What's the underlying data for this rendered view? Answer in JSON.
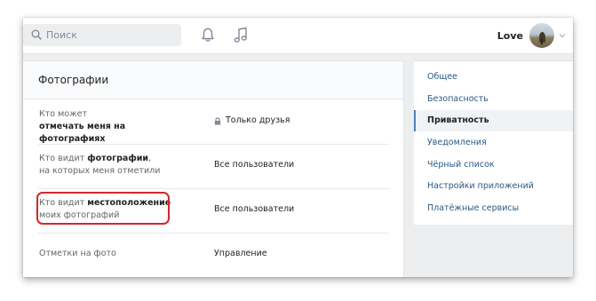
{
  "header": {
    "search_placeholder": "Поиск",
    "user_name": "Love"
  },
  "photos": {
    "title": "Фотографии",
    "rows": [
      {
        "label_pre": "Кто может",
        "label_bold": "отмечать меня на фотографиях",
        "label_post": "",
        "value": "Только друзья",
        "locked": true
      },
      {
        "label_pre": "Кто видит ",
        "label_bold": "фотографии",
        "label_post": ",",
        "label_line2": "на которых меня отметили",
        "value": "Все пользователи",
        "locked": false
      },
      {
        "label_pre": "Кто видит ",
        "label_bold": "местоположение",
        "label_line2": "моих фотографий",
        "value": "Все пользователи",
        "locked": false
      },
      {
        "label": "Отметки на фото",
        "value": "Управление",
        "locked": false
      }
    ]
  },
  "sidebar": {
    "items": [
      {
        "label": "Общее"
      },
      {
        "label": "Безопасность"
      },
      {
        "label": "Приватность",
        "active": true
      },
      {
        "label": "Уведомления"
      },
      {
        "label": "Чёрный список"
      },
      {
        "label": "Настройки приложений"
      },
      {
        "label": "Платёжные сервисы"
      }
    ]
  },
  "colors": {
    "page_bg": "#edeef0",
    "link": "#2a5885",
    "accent": "#5181b8",
    "highlight": "#d4272c"
  }
}
